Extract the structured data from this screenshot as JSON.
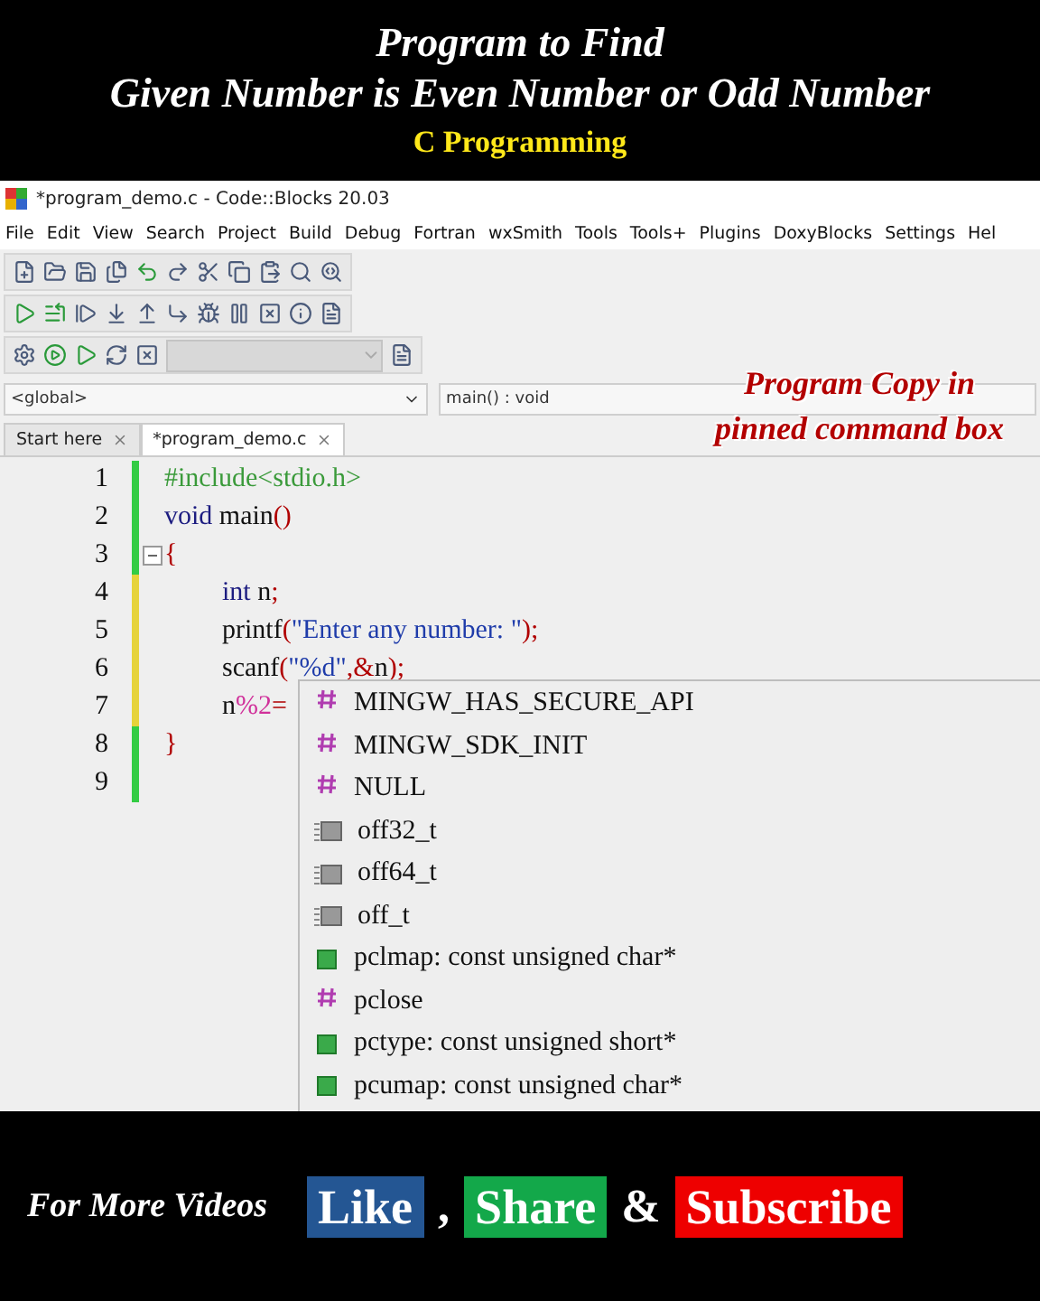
{
  "banner": {
    "title_lines": [
      "Program to Find",
      "Given Number is Even Number or Odd Number"
    ],
    "subtitle": "C Programming"
  },
  "window": {
    "title": "*program_demo.c - Code::Blocks 20.03"
  },
  "menu": [
    "File",
    "Edit",
    "View",
    "Search",
    "Project",
    "Build",
    "Debug",
    "Fortran",
    "wxSmith",
    "Tools",
    "Tools+",
    "Plugins",
    "DoxyBlocks",
    "Settings",
    "Hel"
  ],
  "code_nav": {
    "scope": "<global>",
    "function": "main() : void"
  },
  "tabs": [
    {
      "label": "Start here",
      "selected": false
    },
    {
      "label": "*program_demo.c",
      "selected": true
    }
  ],
  "caption_lines": [
    "Program Copy in",
    "pinned command box"
  ],
  "lines": [
    {
      "number": "1",
      "saved": true,
      "fold": false,
      "indent": false,
      "tokens": [
        {
          "kind": "preproc",
          "text": "#include<stdio.h>"
        }
      ]
    },
    {
      "number": "2",
      "saved": true,
      "fold": false,
      "indent": false,
      "tokens": [
        {
          "kind": "keyword",
          "text": "void"
        },
        {
          "kind": "plain",
          "text": " main"
        },
        {
          "kind": "operator",
          "text": "()"
        }
      ]
    },
    {
      "number": "3",
      "saved": true,
      "fold": true,
      "indent": false,
      "tokens": [
        {
          "kind": "operator",
          "text": "{"
        }
      ]
    },
    {
      "number": "4",
      "saved": false,
      "fold": false,
      "indent": true,
      "tokens": [
        {
          "kind": "keyword",
          "text": "int"
        },
        {
          "kind": "plain",
          "text": " n"
        },
        {
          "kind": "operator",
          "text": ";"
        }
      ]
    },
    {
      "number": "5",
      "saved": false,
      "fold": false,
      "indent": true,
      "tokens": [
        {
          "kind": "plain",
          "text": "printf"
        },
        {
          "kind": "operator",
          "text": "("
        },
        {
          "kind": "string",
          "text": "\"Enter any number: \""
        },
        {
          "kind": "operator",
          "text": ");"
        }
      ]
    },
    {
      "number": "6",
      "saved": false,
      "fold": false,
      "indent": true,
      "tokens": [
        {
          "kind": "plain",
          "text": "scanf"
        },
        {
          "kind": "operator",
          "text": "("
        },
        {
          "kind": "string",
          "text": "\"%d\""
        },
        {
          "kind": "operator",
          "text": ",&"
        },
        {
          "kind": "plain",
          "text": "n"
        },
        {
          "kind": "operator",
          "text": ");"
        }
      ]
    },
    {
      "number": "7",
      "saved": false,
      "fold": false,
      "indent": true,
      "tokens": [
        {
          "kind": "plain",
          "text": "n"
        },
        {
          "kind": "number",
          "text": "%2"
        },
        {
          "kind": "operator",
          "text": "="
        }
      ]
    },
    {
      "number": "8",
      "saved": true,
      "fold": false,
      "indent": false,
      "tokens": [
        {
          "kind": "operator",
          "text": "}"
        }
      ]
    },
    {
      "number": "9",
      "saved": true,
      "fold": false
    }
  ],
  "completions": [
    {
      "kind": "macro",
      "label": "MINGW_HAS_SECURE_API"
    },
    {
      "kind": "macro",
      "label": "MINGW_SDK_INIT"
    },
    {
      "kind": "macro",
      "label": "NULL"
    },
    {
      "kind": "typedef",
      "label": "off32_t"
    },
    {
      "kind": "typedef",
      "label": "off64_t"
    },
    {
      "kind": "typedef",
      "label": "off_t"
    },
    {
      "kind": "variable",
      "label": "pclmap: const unsigned char*"
    },
    {
      "kind": "macro",
      "label": "pclose"
    },
    {
      "kind": "variable",
      "label": "pctype: const unsigned short*"
    },
    {
      "kind": "variable",
      "label": "pcumap: const unsigned char*"
    }
  ],
  "footer": {
    "lead": "For More Videos",
    "buttons": [
      {
        "kind": "like",
        "label": "Like"
      },
      {
        "kind": "separator",
        "label": ","
      },
      {
        "kind": "share",
        "label": "Share"
      },
      {
        "kind": "separator",
        "label": "&"
      },
      {
        "kind": "subscribe",
        "label": "Subscribe"
      }
    ]
  }
}
